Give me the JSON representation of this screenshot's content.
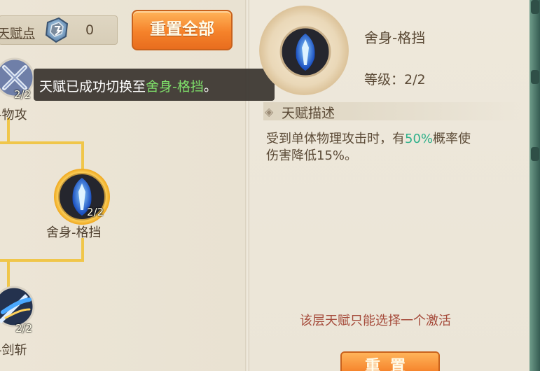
{
  "header": {
    "points_label": "天赋点",
    "points_value": "0",
    "reset_all_label": "重置全部"
  },
  "tree": {
    "nodes": [
      {
        "label": "-物攻",
        "level": "2/2",
        "icon": "crossed-swords-icon"
      },
      {
        "label": "舍身-格挡",
        "level": "2/2",
        "icon": "blue-crystal-shield-icon"
      },
      {
        "label": "-剑斩",
        "level": "2/2",
        "icon": "blue-sword-slash-icon"
      }
    ]
  },
  "toast": {
    "prefix": "天赋已成功切换至",
    "highlight": "舍身-格挡",
    "suffix": "。"
  },
  "detail": {
    "name": "舍身-格挡",
    "level": "等级：2/2",
    "desc_title": "天赋描述",
    "desc_line1_a": "受到单体物理攻击时，有",
    "desc_line1_pct": "50%",
    "desc_line1_b": "概率使",
    "desc_line2": "伤害降低15%。",
    "layer_note": "该层天赋只能选择一个激活",
    "reset_label": "重置"
  },
  "colors": {
    "accent_orange": "#f5822a",
    "highlight_green": "#7fe06a",
    "percent_teal": "#2fb08a",
    "note_red": "#a54a3a",
    "connector_gold": "#f0c64a"
  }
}
